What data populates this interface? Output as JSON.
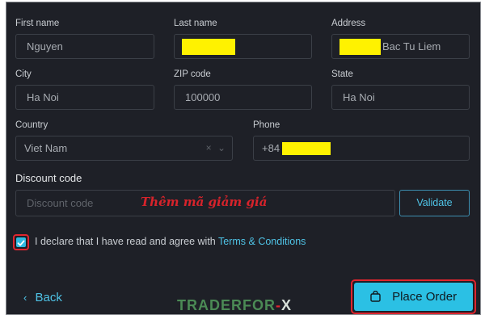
{
  "form": {
    "first_name": {
      "label": "First name",
      "value": "Nguyen"
    },
    "last_name": {
      "label": "Last name",
      "value": ""
    },
    "address": {
      "label": "Address",
      "value": "Bac Tu Liem"
    },
    "city": {
      "label": "City",
      "value": "Ha Noi"
    },
    "zip": {
      "label": "ZIP code",
      "value": "100000"
    },
    "state": {
      "label": "State",
      "value": "Ha Noi"
    },
    "country": {
      "label": "Country",
      "value": "Viet Nam",
      "clear_icon": "×",
      "chevron_icon": "⌄"
    },
    "phone": {
      "label": "Phone",
      "value": "+84"
    }
  },
  "discount": {
    "label": "Discount code",
    "placeholder": "Discount code",
    "validate_label": "Validate",
    "promo_text": "Thêm mã giảm giá"
  },
  "declaration": {
    "checked": true,
    "text": "I declare that I have read and agree with",
    "link": "Terms & Conditions"
  },
  "nav": {
    "back_label": "Back",
    "place_order_label": "Place Order"
  },
  "watermark": {
    "part1": "TRADERFOR",
    "part2": "-",
    "part3": "X"
  },
  "colors": {
    "background": "#1e2027",
    "accent": "#2bc0e4",
    "highlight": "#fff200",
    "annotation": "#e0252e"
  },
  "icons": [
    "chevron-left-icon",
    "bag-icon",
    "check-icon",
    "clear-icon",
    "chevron-down-icon"
  ]
}
